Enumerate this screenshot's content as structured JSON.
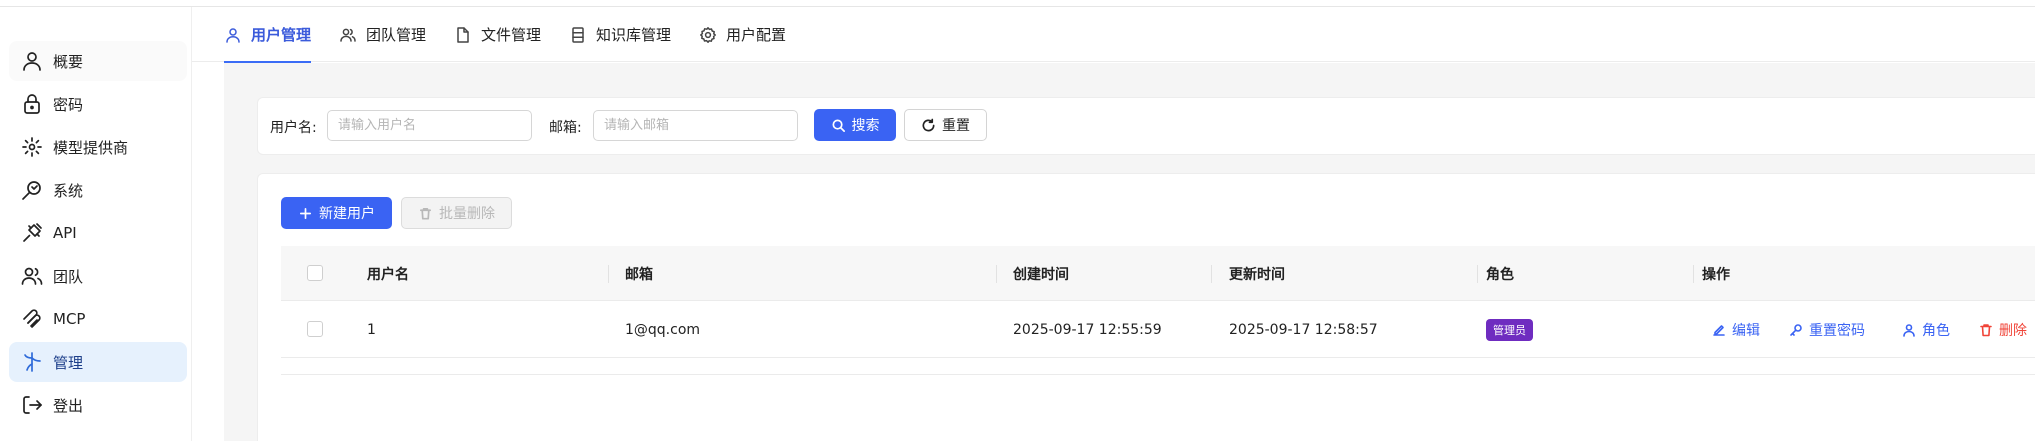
{
  "sidebar": {
    "items": [
      {
        "label": "概要",
        "icon": "user-icon"
      },
      {
        "label": "密码",
        "icon": "lock-icon"
      },
      {
        "label": "模型提供商",
        "icon": "model-icon"
      },
      {
        "label": "系统",
        "icon": "system-icon"
      },
      {
        "label": "API",
        "icon": "plug-icon"
      },
      {
        "label": "团队",
        "icon": "team-icon"
      },
      {
        "label": "MCP",
        "icon": "mcp-icon"
      },
      {
        "label": "管理",
        "icon": "admin-icon"
      },
      {
        "label": "登出",
        "icon": "logout-icon"
      }
    ],
    "active_index": 7
  },
  "tabs": [
    {
      "label": "用户管理",
      "icon": "user-icon",
      "active": true
    },
    {
      "label": "团队管理",
      "icon": "team-icon",
      "active": false
    },
    {
      "label": "文件管理",
      "icon": "file-icon",
      "active": false
    },
    {
      "label": "知识库管理",
      "icon": "database-icon",
      "active": false
    },
    {
      "label": "用户配置",
      "icon": "gear-icon",
      "active": false
    }
  ],
  "search": {
    "username_label": "用户名:",
    "username_placeholder": "请输入用户名",
    "email_label": "邮箱:",
    "email_placeholder": "请输入邮箱",
    "search_button": "搜索",
    "reset_button": "重置"
  },
  "toolbar": {
    "new_user_button": "新建用户",
    "batch_delete_button": "批量删除"
  },
  "table": {
    "columns": [
      "用户名",
      "邮箱",
      "创建时间",
      "更新时间",
      "角色",
      "操作"
    ],
    "rows": [
      {
        "username": "1",
        "email": "1@qq.com",
        "created_at": "2025-09-17 12:55:59",
        "updated_at": "2025-09-17 12:58:57",
        "role": "管理员",
        "actions": {
          "edit": "编辑",
          "reset_password": "重置密码",
          "role": "角色",
          "delete": "删除"
        }
      }
    ]
  },
  "colors": {
    "primary": "#3a63f3",
    "danger": "#f04438",
    "role_tag": "#6f2cc0",
    "active_nav_bg": "#e6f1fd"
  }
}
